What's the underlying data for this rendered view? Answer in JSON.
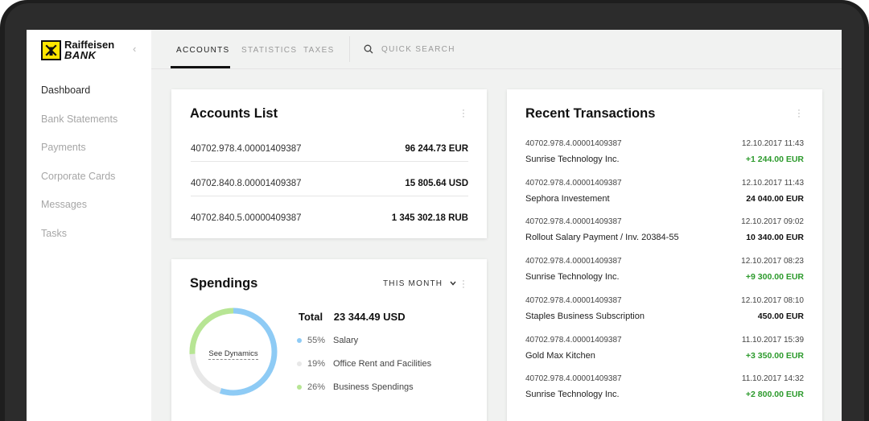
{
  "brand": {
    "line1": "Raiffeisen",
    "line2": "BANK",
    "yellow": "#ffe600"
  },
  "sidebar": {
    "items": [
      {
        "label": "Dashboard",
        "active": true
      },
      {
        "label": "Bank Statements"
      },
      {
        "label": "Payments"
      },
      {
        "label": "Corporate Cards"
      },
      {
        "label": "Messages"
      },
      {
        "label": "Tasks"
      }
    ]
  },
  "topbar": {
    "tabs": [
      {
        "label": "ACCOUNTS",
        "active": true
      },
      {
        "label": "STATISTICS"
      },
      {
        "label": "TAXES"
      }
    ],
    "search_placeholder": "QUICK SEARCH"
  },
  "accounts": {
    "title": "Accounts List",
    "rows": [
      {
        "number": "40702.978.4.00001409387",
        "amount": "96 244.73 EUR"
      },
      {
        "number": "40702.840.8.00001409387",
        "amount": "15 805.64 USD"
      },
      {
        "number": "40702.840.5.00000409387",
        "amount": "1 345 302.18 RUB"
      }
    ]
  },
  "spendings": {
    "title": "Spendings",
    "period": "THIS MONTH",
    "center_link": "See Dynamics",
    "total_label": "Total",
    "total_value": "23 344.49 USD",
    "segments": [
      {
        "pct": "55%",
        "fraction": 0.55,
        "label": "Salary",
        "color": "#8ecbf5"
      },
      {
        "pct": "19%",
        "fraction": 0.19,
        "label": "Office Rent and Facilities",
        "color": "#e8e8e8"
      },
      {
        "pct": "26%",
        "fraction": 0.26,
        "label": "Business Spendings",
        "color": "#b7e594"
      }
    ]
  },
  "transactions": {
    "title": "Recent Transactions",
    "positive_color": "#2c9a2c",
    "items": [
      {
        "account": "40702.978.4.00001409387",
        "datetime": "12.10.2017 11:43",
        "description": "Sunrise Technology Inc.",
        "amount": "+1 244.00 EUR",
        "positive": true
      },
      {
        "account": "40702.978.4.00001409387",
        "datetime": "12.10.2017 11:43",
        "description": "Sephora Investement",
        "amount": "24 040.00 EUR",
        "positive": false
      },
      {
        "account": "40702.978.4.00001409387",
        "datetime": "12.10.2017 09:02",
        "description": "Rollout Salary Payment / Inv. 20384-55",
        "amount": "10 340.00 EUR",
        "positive": false
      },
      {
        "account": "40702.978.4.00001409387",
        "datetime": "12.10.2017 08:23",
        "description": "Sunrise Technology Inc.",
        "amount": "+9 300.00 EUR",
        "positive": true
      },
      {
        "account": "40702.978.4.00001409387",
        "datetime": "12.10.2017 08:10",
        "description": "Staples Business Subscription",
        "amount": "450.00 EUR",
        "positive": false
      },
      {
        "account": "40702.978.4.00001409387",
        "datetime": "11.10.2017 15:39",
        "description": "Gold Max Kitchen",
        "amount": "+3 350.00 EUR",
        "positive": true
      },
      {
        "account": "40702.978.4.00001409387",
        "datetime": "11.10.2017 14:32",
        "description": "Sunrise Technology Inc.",
        "amount": "+2 800.00 EUR",
        "positive": true
      }
    ]
  }
}
